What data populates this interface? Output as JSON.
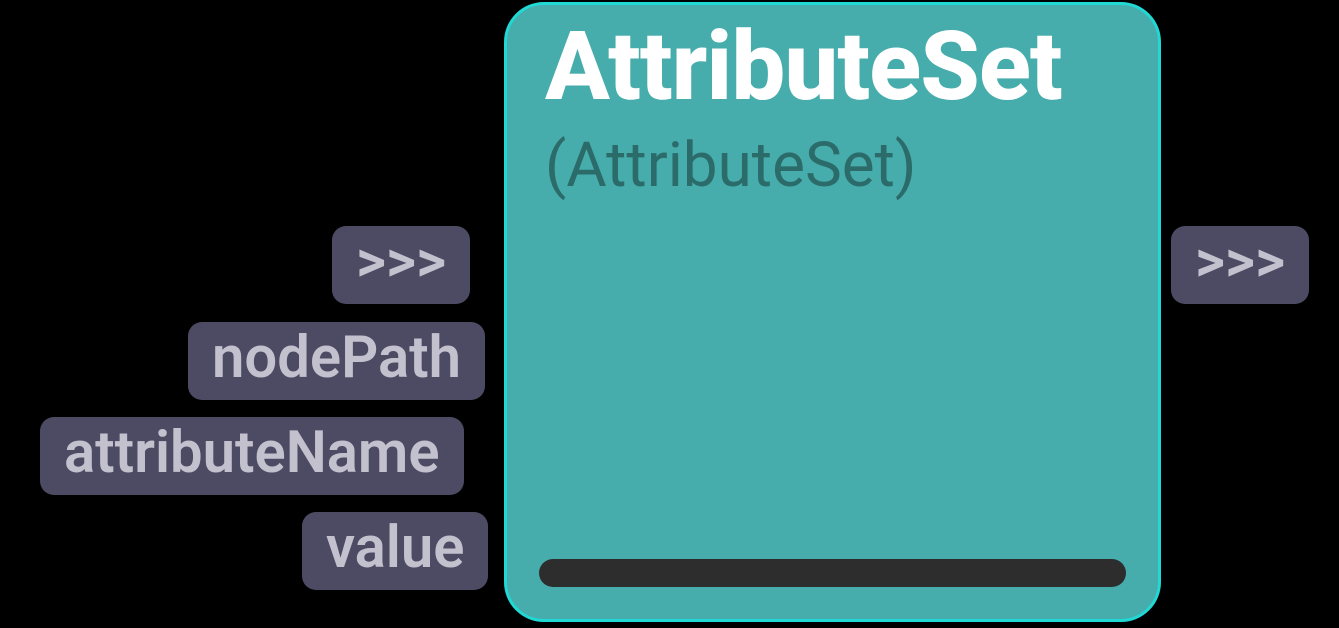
{
  "node": {
    "title": "AttributeSet",
    "type_label": "(AttributeSet)"
  },
  "inputs": {
    "exec": ">>>",
    "p1": "nodePath",
    "p2": "attributeName",
    "p3": "value"
  },
  "outputs": {
    "exec": ">>>"
  }
}
